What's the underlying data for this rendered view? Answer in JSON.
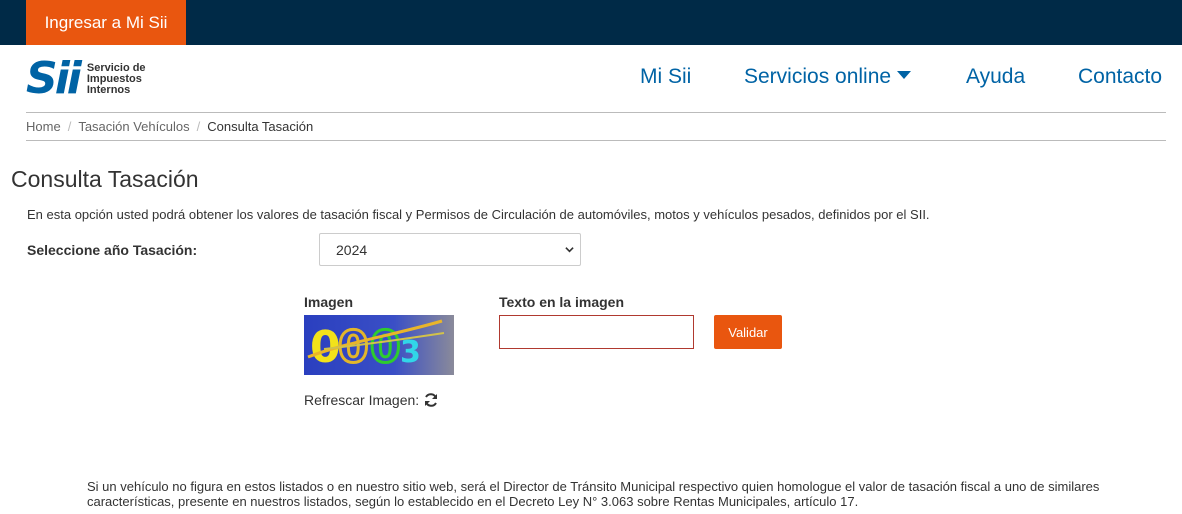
{
  "topbar": {
    "login_label": "Ingresar a Mi Sii"
  },
  "logo": {
    "mark": "Sii",
    "text_line1": "Servicio de",
    "text_line2": "Impuestos",
    "text_line3": "Internos"
  },
  "nav": {
    "items": [
      {
        "label": "Mi Sii"
      },
      {
        "label": "Servicios online",
        "icon": "caret-down-icon"
      },
      {
        "label": "Ayuda"
      },
      {
        "label": "Contacto"
      }
    ]
  },
  "breadcrumb": {
    "items": [
      {
        "label": "Home"
      },
      {
        "label": "Tasación Vehículos"
      },
      {
        "label": "Consulta Tasación"
      }
    ],
    "separator": "/"
  },
  "main": {
    "title": "Consulta Tasación",
    "intro": "En esta opción usted podrá obtener los valores de tasación fiscal y Permisos de Circulación de automóviles, motos y vehículos pesados, definidos por el SII.",
    "year_label": "Seleccione año Tasación:",
    "year_selected": "2024",
    "image_label": "Imagen",
    "captcha_text": "0003",
    "text_label": "Texto en la imagen",
    "captcha_input_value": "",
    "validate_label": "Validar",
    "refresh_label": "Refrescar Imagen:",
    "footer_note": "Si un vehículo no figura en estos listados o en nuestro sitio web, será el Director de Tránsito Municipal respectivo quien homologue el valor de tasación fiscal a uno de similares características, presente en nuestros listados, según lo establecido en el Decreto Ley N° 3.063 sobre Rentas Municipales, artículo 17."
  },
  "colors": {
    "topbar_bg": "#002a47",
    "accent_orange": "#e9560f",
    "link_blue": "#0063a5"
  }
}
